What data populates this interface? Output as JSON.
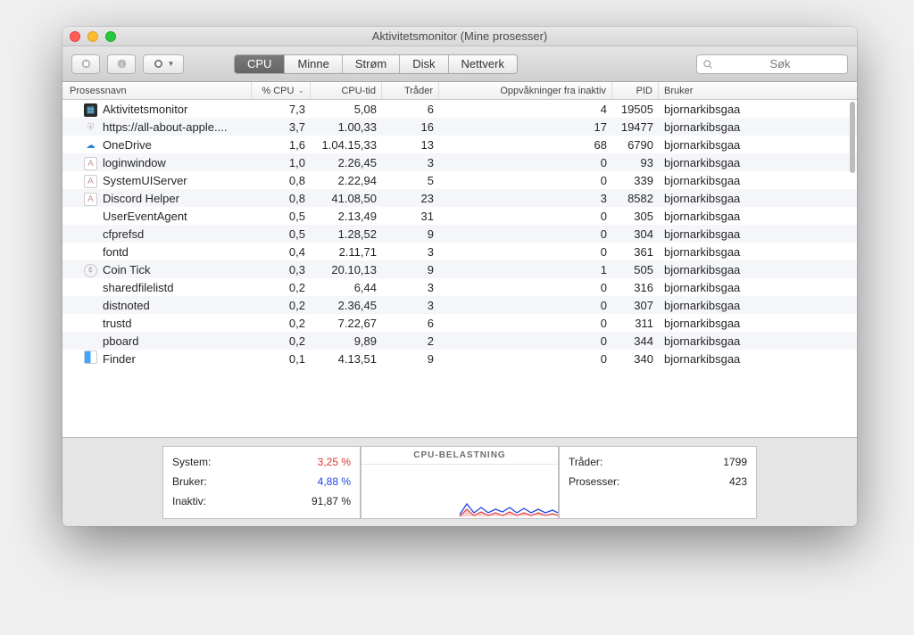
{
  "window": {
    "title": "Aktivitetsmonitor (Mine prosesser)"
  },
  "toolbar": {
    "tabs": [
      "CPU",
      "Minne",
      "Strøm",
      "Disk",
      "Nettverk"
    ],
    "active_tab": 0,
    "search_placeholder": "Søk"
  },
  "columns": {
    "name": "Prosessnavn",
    "cpu": "% CPU",
    "time": "CPU-tid",
    "threads": "Tråder",
    "wake": "Oppvåkninger fra inaktiv",
    "pid": "PID",
    "user": "Bruker"
  },
  "rows": [
    {
      "icon": "monitor",
      "name": "Aktivitetsmonitor",
      "cpu": "7,3",
      "time": "5,08",
      "thr": "6",
      "wake": "4",
      "pid": "19505",
      "user": "bjornarkibsgaa"
    },
    {
      "icon": "shield",
      "name": "https://all-about-apple....",
      "cpu": "3,7",
      "time": "1.00,33",
      "thr": "16",
      "wake": "17",
      "pid": "19477",
      "user": "bjornarkibsgaa"
    },
    {
      "icon": "cloud",
      "name": "OneDrive",
      "cpu": "1,6",
      "time": "1.04.15,33",
      "thr": "13",
      "wake": "68",
      "pid": "6790",
      "user": "bjornarkibsgaa"
    },
    {
      "icon": "app",
      "name": "loginwindow",
      "cpu": "1,0",
      "time": "2.26,45",
      "thr": "3",
      "wake": "0",
      "pid": "93",
      "user": "bjornarkibsgaa"
    },
    {
      "icon": "app",
      "name": "SystemUIServer",
      "cpu": "0,8",
      "time": "2.22,94",
      "thr": "5",
      "wake": "0",
      "pid": "339",
      "user": "bjornarkibsgaa"
    },
    {
      "icon": "app",
      "name": "Discord Helper",
      "cpu": "0,8",
      "time": "41.08,50",
      "thr": "23",
      "wake": "3",
      "pid": "8582",
      "user": "bjornarkibsgaa"
    },
    {
      "icon": "",
      "name": "UserEventAgent",
      "cpu": "0,5",
      "time": "2.13,49",
      "thr": "31",
      "wake": "0",
      "pid": "305",
      "user": "bjornarkibsgaa"
    },
    {
      "icon": "",
      "name": "cfprefsd",
      "cpu": "0,5",
      "time": "1.28,52",
      "thr": "9",
      "wake": "0",
      "pid": "304",
      "user": "bjornarkibsgaa"
    },
    {
      "icon": "",
      "name": "fontd",
      "cpu": "0,4",
      "time": "2.11,71",
      "thr": "3",
      "wake": "0",
      "pid": "361",
      "user": "bjornarkibsgaa"
    },
    {
      "icon": "coin",
      "name": "Coin Tick",
      "cpu": "0,3",
      "time": "20.10,13",
      "thr": "9",
      "wake": "1",
      "pid": "505",
      "user": "bjornarkibsgaa"
    },
    {
      "icon": "",
      "name": "sharedfilelistd",
      "cpu": "0,2",
      "time": "6,44",
      "thr": "3",
      "wake": "0",
      "pid": "316",
      "user": "bjornarkibsgaa"
    },
    {
      "icon": "",
      "name": "distnoted",
      "cpu": "0,2",
      "time": "2.36,45",
      "thr": "3",
      "wake": "0",
      "pid": "307",
      "user": "bjornarkibsgaa"
    },
    {
      "icon": "",
      "name": "trustd",
      "cpu": "0,2",
      "time": "7.22,67",
      "thr": "6",
      "wake": "0",
      "pid": "311",
      "user": "bjornarkibsgaa"
    },
    {
      "icon": "",
      "name": "pboard",
      "cpu": "0,2",
      "time": "9,89",
      "thr": "2",
      "wake": "0",
      "pid": "344",
      "user": "bjornarkibsgaa"
    },
    {
      "icon": "finder",
      "name": "Finder",
      "cpu": "0,1",
      "time": "4.13,51",
      "thr": "9",
      "wake": "0",
      "pid": "340",
      "user": "bjornarkibsgaa"
    }
  ],
  "summary": {
    "left": {
      "system_label": "System:",
      "system_value": "3,25 %",
      "user_label": "Bruker:",
      "user_value": "4,88 %",
      "idle_label": "Inaktiv:",
      "idle_value": "91,87 %"
    },
    "mid_title": "CPU-BELASTNING",
    "right": {
      "threads_label": "Tråder:",
      "threads_value": "1799",
      "procs_label": "Prosesser:",
      "procs_value": "423"
    }
  }
}
